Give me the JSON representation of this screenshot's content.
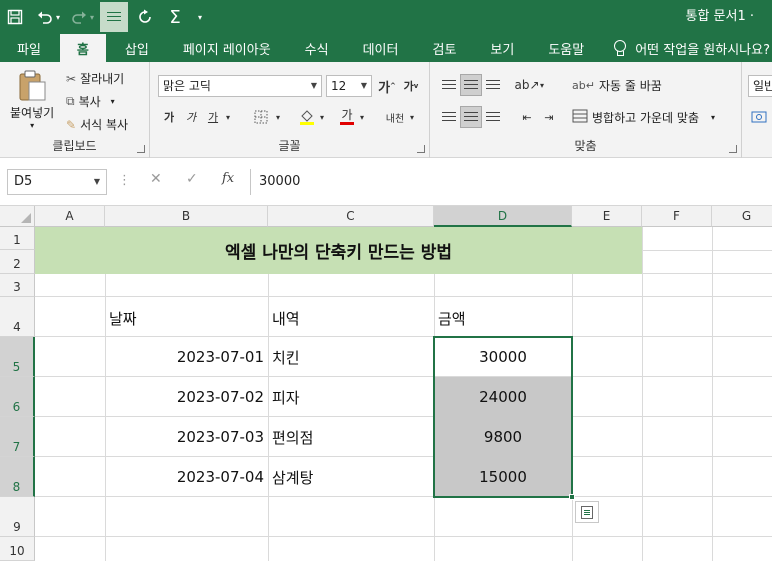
{
  "titlebar": {
    "doc_title": "통합 문서1 ·",
    "qat": {
      "save_icon": "save-icon",
      "undo_icon": "undo-icon",
      "redo_icon": "redo-icon",
      "format_icon": "align-icon",
      "refresh_icon": "refresh-icon",
      "sum_icon": "autosum-icon"
    }
  },
  "tabs": [
    "파일",
    "홈",
    "삽입",
    "페이지 레이아웃",
    "수식",
    "데이터",
    "검토",
    "보기",
    "도움말"
  ],
  "active_tab": "홈",
  "tell_me": "어떤 작업을 원하시나요?",
  "ribbon": {
    "clipboard": {
      "label": "클립보드",
      "paste": "붙여넣기",
      "cut": "잘라내기",
      "copy": "복사",
      "format_painter": "서식 복사"
    },
    "font": {
      "label": "글꼴",
      "font_name": "맑은 고딕",
      "font_size": "12",
      "grow": "가",
      "shrink": "가",
      "bold": "가",
      "italic": "가",
      "underline": "가",
      "font_color_glyph": "가",
      "phonetic": "내천"
    },
    "alignment": {
      "label": "맞춤",
      "wrap_text": "자동 줄 바꿈",
      "merge_center": "병합하고 가운데 맞춤"
    },
    "number": {
      "format": "일반"
    }
  },
  "formula_bar": {
    "name_box": "D5",
    "formula": "30000",
    "fx": "fx"
  },
  "columns": [
    "A",
    "B",
    "C",
    "D",
    "E",
    "F",
    "G"
  ],
  "rows": [
    "1",
    "2",
    "3",
    "4",
    "5",
    "6",
    "7",
    "8",
    "9",
    "10"
  ],
  "sheet": {
    "title": "엑셀 나만의 단축키 만드는 방법",
    "headers": {
      "date": "날짜",
      "item": "내역",
      "amount": "금액"
    },
    "data": [
      {
        "date": "2023-07-01",
        "item": "치킨",
        "amount": "30000"
      },
      {
        "date": "2023-07-02",
        "item": "피자",
        "amount": "24000"
      },
      {
        "date": "2023-07-03",
        "item": "편의점",
        "amount": "9800"
      },
      {
        "date": "2023-07-04",
        "item": "삼계탕",
        "amount": "15000"
      }
    ]
  },
  "colors": {
    "excel_green": "#217346",
    "title_fill": "#c6e0b4",
    "selection_shade": "#c8c8c8"
  }
}
